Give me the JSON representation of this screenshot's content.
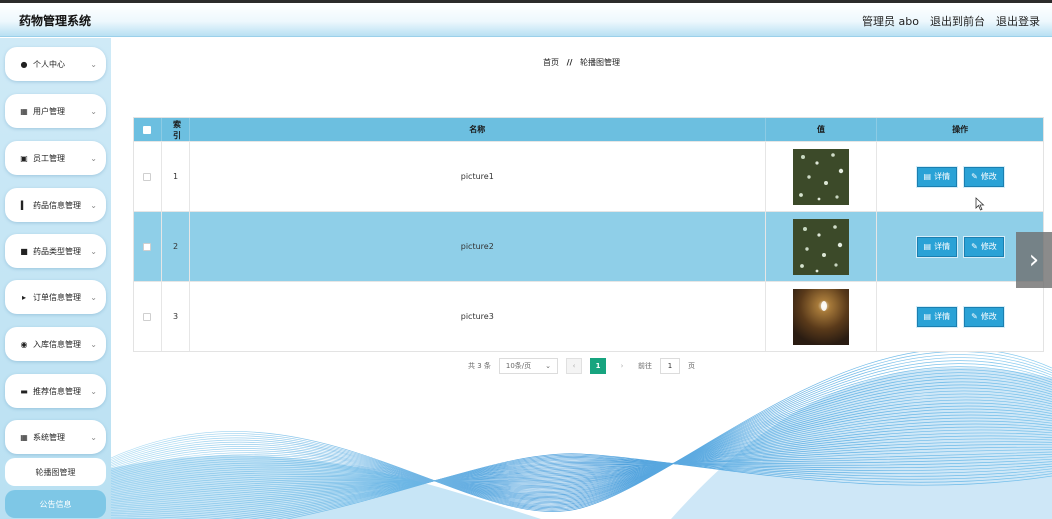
{
  "header": {
    "title": "药物管理系统",
    "user_label": "管理员 abo",
    "exit_front": "退出到前台",
    "logout": "退出登录"
  },
  "sidebar": {
    "items": [
      {
        "label": "个人中心",
        "icon": "user-icon"
      },
      {
        "label": "用户管理",
        "icon": "grid-icon"
      },
      {
        "label": "员工管理",
        "icon": "clipboard-icon"
      },
      {
        "label": "药品信息管理",
        "icon": "bar-chart-icon"
      },
      {
        "label": "药品类型管理",
        "icon": "briefcase-icon"
      },
      {
        "label": "订单信息管理",
        "icon": "video-icon"
      },
      {
        "label": "入库信息管理",
        "icon": "location-icon"
      },
      {
        "label": "推荐信息管理",
        "icon": "monitor-icon"
      },
      {
        "label": "系统管理",
        "icon": "apps-icon"
      }
    ],
    "sub_items": [
      {
        "label": "轮播图管理"
      },
      {
        "label": "公告信息"
      }
    ]
  },
  "breadcrumb": {
    "home": "首页",
    "separator": "//",
    "current": "轮播图管理"
  },
  "table": {
    "headers": {
      "index": "索引",
      "name": "名称",
      "value": "值",
      "actions": "操作"
    },
    "rows": [
      {
        "index": "1",
        "name": "picture1",
        "detail": "详情",
        "edit": "修改",
        "thumb": "raindrops-dark"
      },
      {
        "index": "2",
        "name": "picture2",
        "detail": "详情",
        "edit": "修改",
        "thumb": "raindrops-dark"
      },
      {
        "index": "3",
        "name": "picture3",
        "detail": "详情",
        "edit": "修改",
        "thumb": "bokeh-amber"
      }
    ]
  },
  "pagination": {
    "total": "共 3 条",
    "page_size": "10条/页",
    "current_page": "1",
    "goto_label": "前往",
    "goto_value": "1",
    "page_unit": "页"
  },
  "colors": {
    "accent": "#6cbfe0",
    "button": "#2aa2d6",
    "page_active": "#17a47f",
    "row_highlight": "#8fcfe8"
  }
}
